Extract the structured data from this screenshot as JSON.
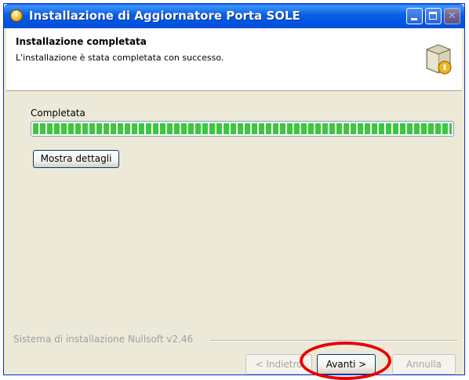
{
  "window": {
    "title": "Installazione di Aggiornatore Porta SOLE",
    "title_icon": "installer-app-icon",
    "controls": [
      "minimize-icon",
      "maximize-icon",
      "close-icon"
    ]
  },
  "header": {
    "title": "Installazione completata",
    "subtitle": "L'installazione è stata completata con successo.",
    "icon": "installer-box-icon"
  },
  "content": {
    "status_label": "Completata",
    "progress_fraction": 1.0,
    "details_button": "Mostra dettagli"
  },
  "footer": {
    "branding": "Sistema di installazione Nullsoft v2.46",
    "back_button": "< Indietro",
    "next_button": "Avanti >",
    "cancel_button": "Annulla"
  },
  "colors": {
    "titlebar": "#0054e3",
    "progress": "#3ec63e",
    "highlight": "#e60000",
    "dialog_bg": "#ece9d8"
  }
}
